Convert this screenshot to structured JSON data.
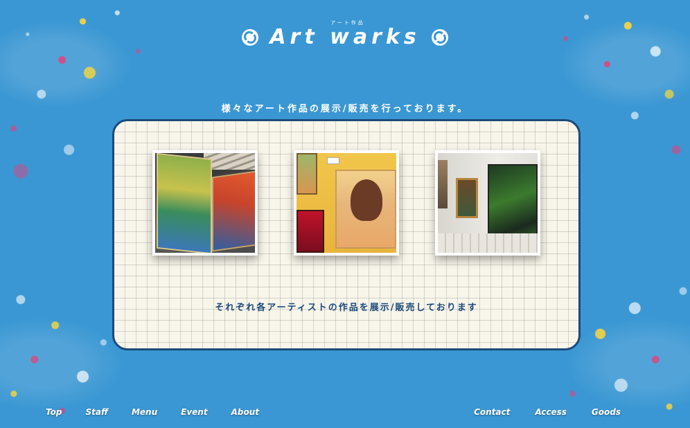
{
  "header": {
    "subtitle": "アート作品",
    "title": "Art warks",
    "left_icon": "swirl-icon",
    "right_icon": "swirl-icon"
  },
  "tagline": "様々なアート作品の展示/販売を行っております。",
  "panel": {
    "photos": [
      {
        "name": "gallery-photo-1"
      },
      {
        "name": "gallery-photo-2"
      },
      {
        "name": "gallery-photo-3"
      }
    ],
    "caption": "それぞれ各アーティストの作品を展示/販売しております"
  },
  "nav_left": [
    "Top",
    "Staff",
    "Menu",
    "Event",
    "About"
  ],
  "nav_right": [
    "Contact",
    "Access",
    "Goods"
  ],
  "colors": {
    "background": "#3a97d3",
    "panel_border": "#1b4a79",
    "panel_bg": "#f8f5ea",
    "caption_text": "#1b4a79"
  }
}
